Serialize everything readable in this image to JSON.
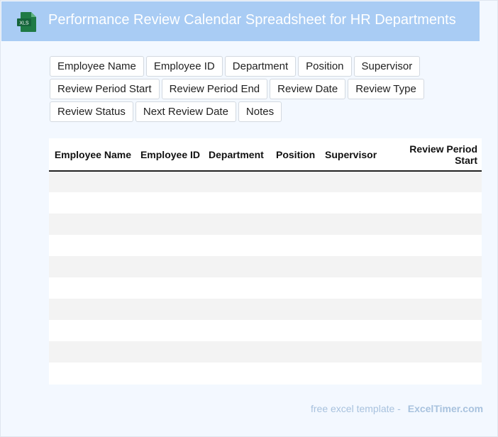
{
  "header": {
    "title": "Performance Review Calendar Spreadsheet for HR Departments",
    "icon_label": "XLS",
    "icon": "excel-file-icon",
    "colors": {
      "header_bg": "#a9ccf4",
      "icon_green": "#1f7a45"
    }
  },
  "fields": [
    "Employee Name",
    "Employee ID",
    "Department",
    "Position",
    "Supervisor",
    "Review Period Start",
    "Review Period End",
    "Review Date",
    "Review Type",
    "Review Status",
    "Next Review Date",
    "Notes"
  ],
  "table": {
    "columns": [
      {
        "label": "Employee Name",
        "align": "right"
      },
      {
        "label": "Employee ID",
        "align": "right"
      },
      {
        "label": "Department",
        "align": "left"
      },
      {
        "label": "Position",
        "align": "left"
      },
      {
        "label": "Supervisor",
        "align": "left"
      },
      {
        "label": "Review Period Start",
        "align": "right"
      }
    ],
    "row_count": 10
  },
  "footer": {
    "text": "free excel template -",
    "brand": "ExcelTimer.com"
  }
}
